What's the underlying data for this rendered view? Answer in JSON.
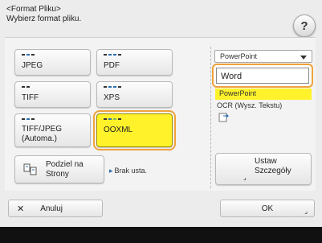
{
  "header": {
    "title": "<Format Pliku>",
    "subtitle": "Wybierz format pliku."
  },
  "help": {
    "label": "?"
  },
  "formats": {
    "jpeg": "JPEG",
    "pdf": "PDF",
    "tiff": "TIFF",
    "xps": "XPS",
    "tiff_jpeg_line1": "TIFF/JPEG",
    "tiff_jpeg_line2": "(Automa.)",
    "ooxml": "OOXML"
  },
  "split": {
    "line1": "Podziel na",
    "line2": "Strony",
    "status": "Brak usta."
  },
  "right_panel": {
    "dropdown_value": "PowerPoint",
    "option_word": "Word",
    "option_powerpoint": "PowerPoint",
    "ocr_label": "OCR (Wysz. Tekstu)",
    "detail_line1": "Ustaw",
    "detail_line2": "Szczegóły"
  },
  "footer": {
    "cancel_label": "Anuluj",
    "ok_label": "OK"
  },
  "colors": {
    "selected": "#fff22a",
    "highlight": "#f0a23b"
  }
}
